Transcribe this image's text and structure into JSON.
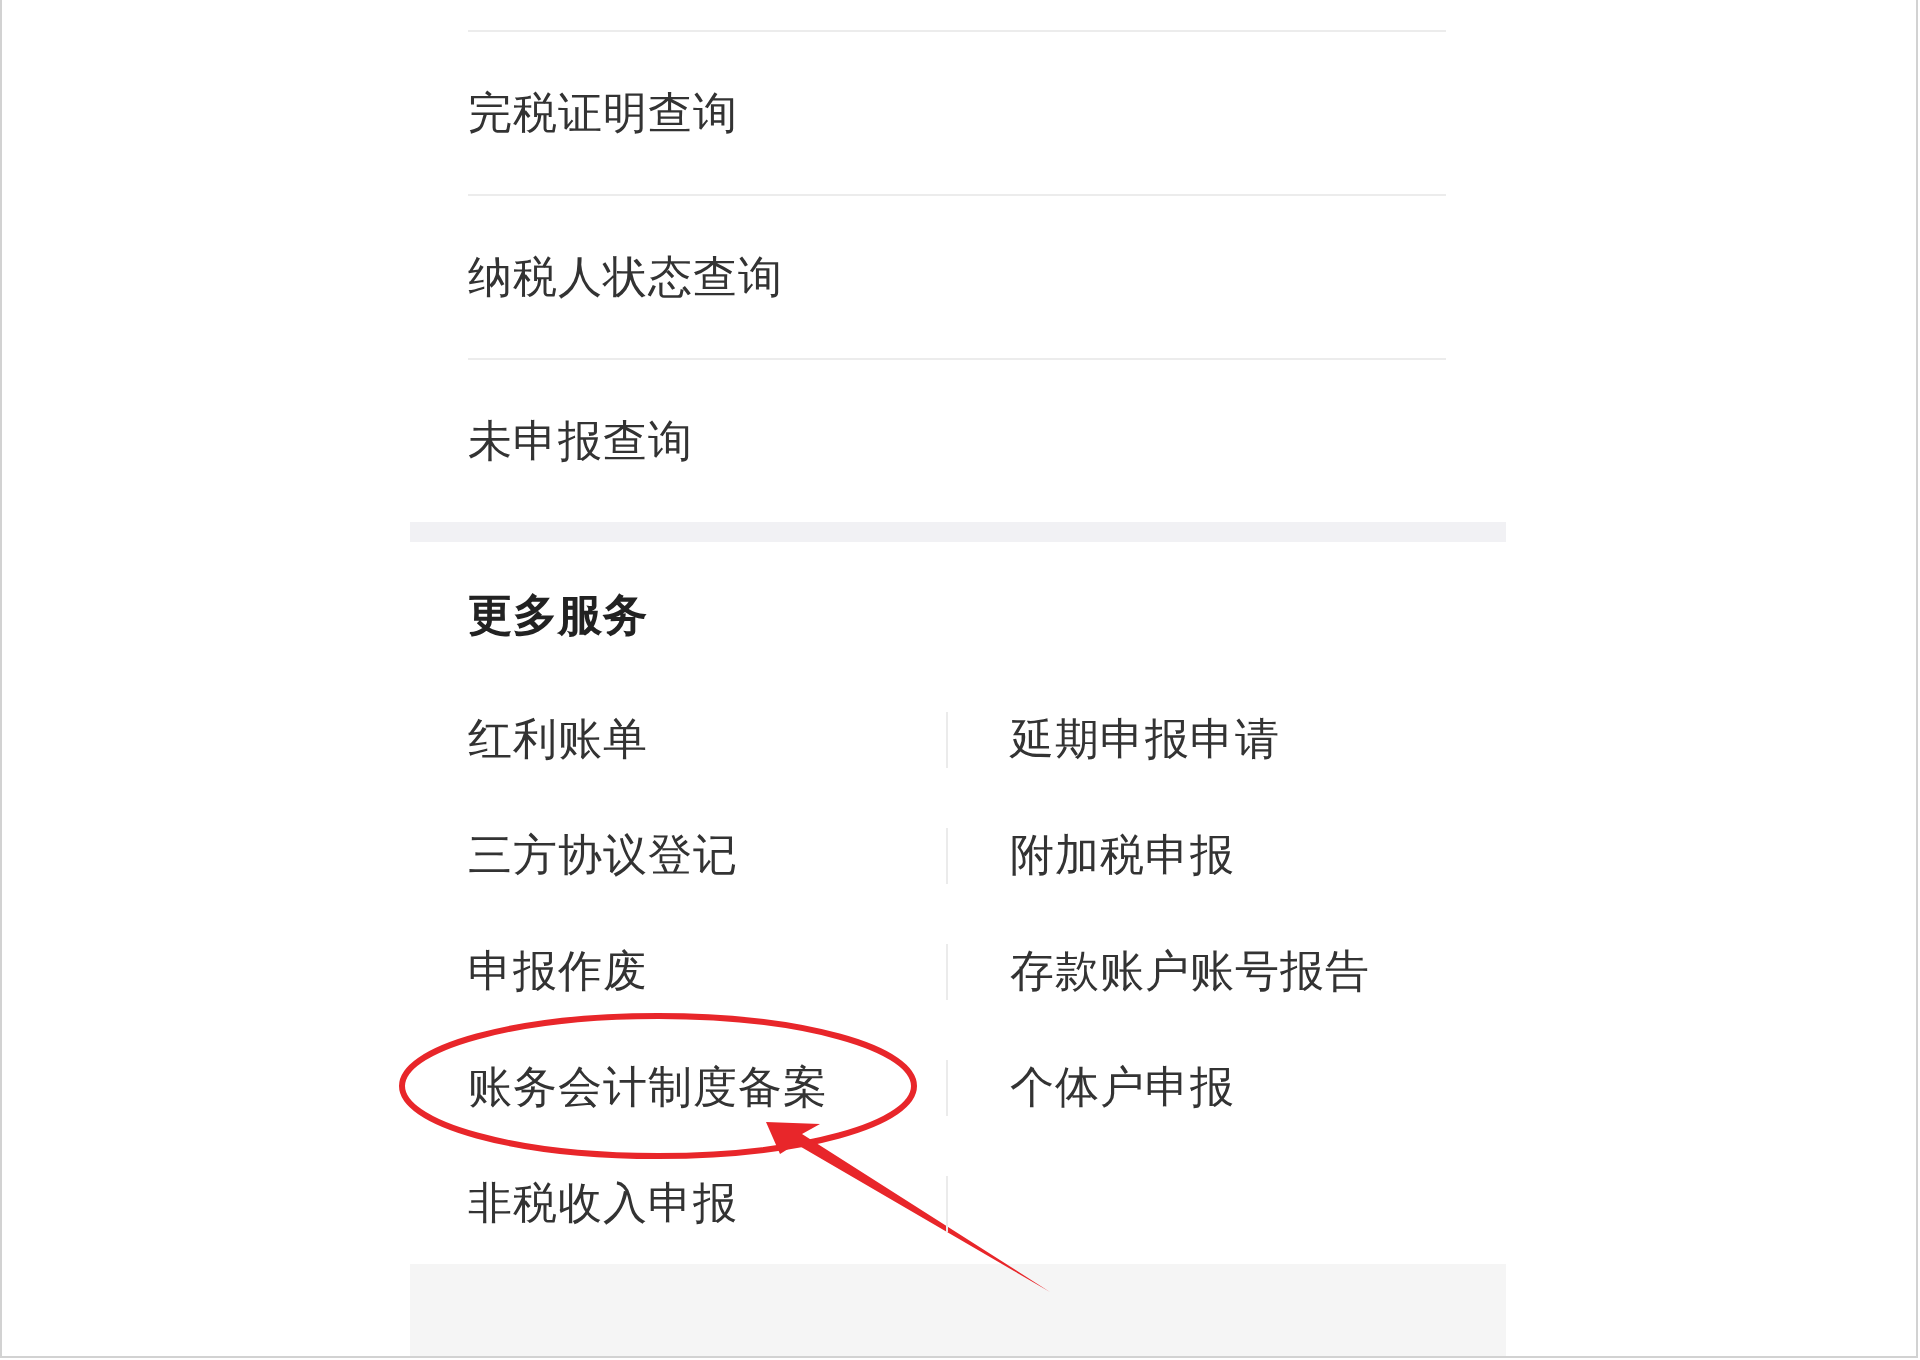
{
  "query_list": {
    "items": [
      "完税证明查询",
      "纳税人状态查询",
      "未申报查询"
    ]
  },
  "more_services": {
    "title": "更多服务",
    "items": [
      {
        "label": "红利账单",
        "circled": false
      },
      {
        "label": "延期申报申请",
        "circled": false
      },
      {
        "label": "三方协议登记",
        "circled": false
      },
      {
        "label": "附加税申报",
        "circled": false
      },
      {
        "label": "申报作废",
        "circled": false
      },
      {
        "label": "存款账户账号报告",
        "circled": false
      },
      {
        "label": "账务会计制度备案",
        "circled": true
      },
      {
        "label": "个体户申报",
        "circled": false
      },
      {
        "label": "非税收入申报",
        "circled": false
      }
    ]
  }
}
